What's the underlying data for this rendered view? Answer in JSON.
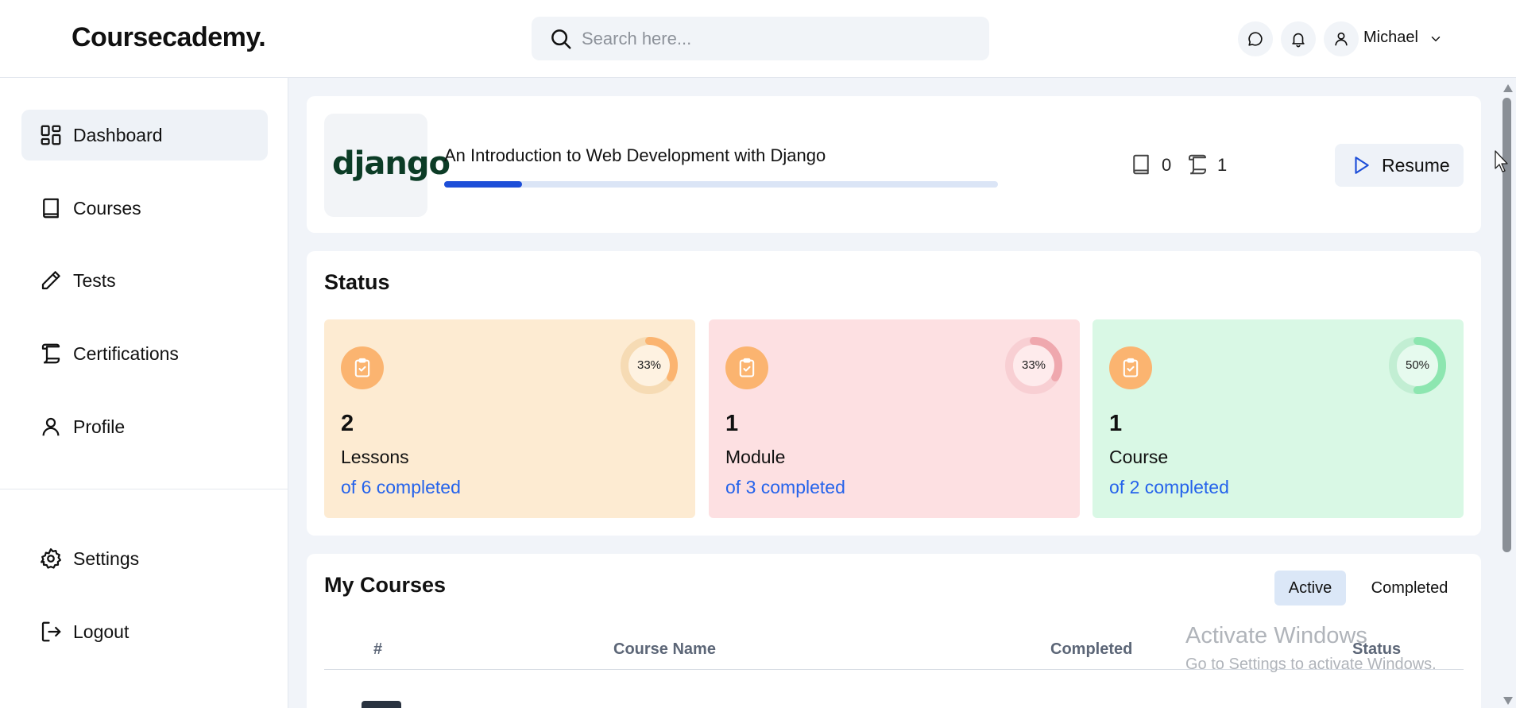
{
  "header": {
    "brand": "Coursecademy.",
    "search_placeholder": "Search here...",
    "user_name": "Michael"
  },
  "sidebar": {
    "items": [
      {
        "label": "Dashboard",
        "icon": "grid-icon",
        "active": true
      },
      {
        "label": "Courses",
        "icon": "book-icon"
      },
      {
        "label": "Tests",
        "icon": "pencil-icon"
      },
      {
        "label": "Certifications",
        "icon": "scroll-icon"
      },
      {
        "label": "Profile",
        "icon": "user-icon"
      }
    ],
    "bottom_items": [
      {
        "label": "Settings",
        "icon": "gear-icon"
      },
      {
        "label": "Logout",
        "icon": "logout-icon"
      }
    ]
  },
  "current_course": {
    "logo_text": "django",
    "title": "An Introduction to Web Development with Django",
    "progress_percent": 14,
    "lessons_count": "0",
    "certificates_count": "1",
    "resume_label": "Resume"
  },
  "status": {
    "title": "Status",
    "cards": [
      {
        "count": "2",
        "name": "Lessons",
        "sub": "of 6 completed",
        "percent": 33,
        "percent_label": "33%",
        "bg": "#fdebd2",
        "ring_fg": "#fbb470",
        "ring_bg": "#f6dbb4"
      },
      {
        "count": "1",
        "name": "Module",
        "sub": "of 3 completed",
        "percent": 33,
        "percent_label": "33%",
        "bg": "#fde0e2",
        "ring_fg": "#efa8ae",
        "ring_bg": "#f8cfd3"
      },
      {
        "count": "1",
        "name": "Course",
        "sub": "of 2 completed",
        "percent": 50,
        "percent_label": "50%",
        "bg": "#d9f8e5",
        "ring_fg": "#8de6b0",
        "ring_bg": "#c2eed3"
      }
    ]
  },
  "my_courses": {
    "title": "My Courses",
    "tabs": [
      {
        "label": "Active",
        "active": true
      },
      {
        "label": "Completed"
      }
    ],
    "columns": [
      "#",
      "Course Name",
      "Completed",
      "Status"
    ]
  },
  "watermark": {
    "line1": "Activate Windows",
    "line2": "Go to Settings to activate Windows."
  },
  "colors": {
    "accent": "#1d4ed8",
    "link": "#2563eb",
    "clip_badge": "#fbb470"
  }
}
